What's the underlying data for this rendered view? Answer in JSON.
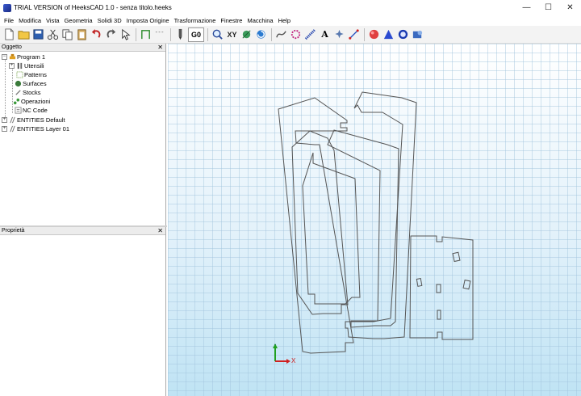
{
  "window": {
    "title": "TRIAL VERSION of HeeksCAD 1.0 - senza titolo.heeks",
    "minimize": "—",
    "maximize": "☐",
    "close": "✕"
  },
  "menu": [
    "File",
    "Modifica",
    "Vista",
    "Geometria",
    "Solidi 3D",
    "Imposta Origine",
    "Trasformazione",
    "Finestre",
    "Macchina",
    "Help"
  ],
  "toolbar": {
    "g0_label": "G0",
    "xy_label": "XY",
    "text_label": "A"
  },
  "objects_panel": {
    "title": "Oggetto",
    "close": "✕",
    "tree": {
      "program": "Program 1",
      "utensili": "Utensili",
      "patterns": "Patterns",
      "surfaces": "Surfaces",
      "stocks": "Stocks",
      "operazioni": "Operazioni",
      "nc_code": "NC Code",
      "entities_default": "ENTITIES Default",
      "entities_layer": "ENTITIES Layer 01",
      "expander_minus": "−",
      "expander_plus": "+"
    }
  },
  "props_panel": {
    "title": "Proprietà",
    "close": "✕"
  },
  "viewport": {
    "axis_x_label": "X",
    "colors": {
      "geometry": "#555555",
      "axis_x": "#d02020",
      "axis_y": "#20a020",
      "axis_z": "#2020d0"
    }
  }
}
